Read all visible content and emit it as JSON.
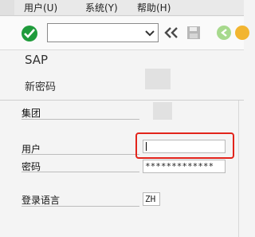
{
  "menu": {
    "items": [
      "用户(U)",
      "系统(Y)",
      "帮助(H)"
    ]
  },
  "toolbar": {
    "command_value": "",
    "icons": [
      "enter-check-icon",
      "dropdown-chevron-icon",
      "double-chevron-left-icon",
      "save-disk-icon",
      "back-arrow-icon",
      "exit-icon"
    ],
    "colors": {
      "enter": "#1f9b3b",
      "back": "#a7d98d",
      "exit": "#f2b530",
      "highlight": "#e2241b"
    }
  },
  "app": {
    "title": "SAP",
    "subtitle": "新密码"
  },
  "form": {
    "client_label": "集团",
    "client_value": "",
    "user_label": "用户",
    "user_value": "",
    "password_label": "密码",
    "password_value": "*************",
    "language_label": "登录语言",
    "language_value": "ZH"
  }
}
